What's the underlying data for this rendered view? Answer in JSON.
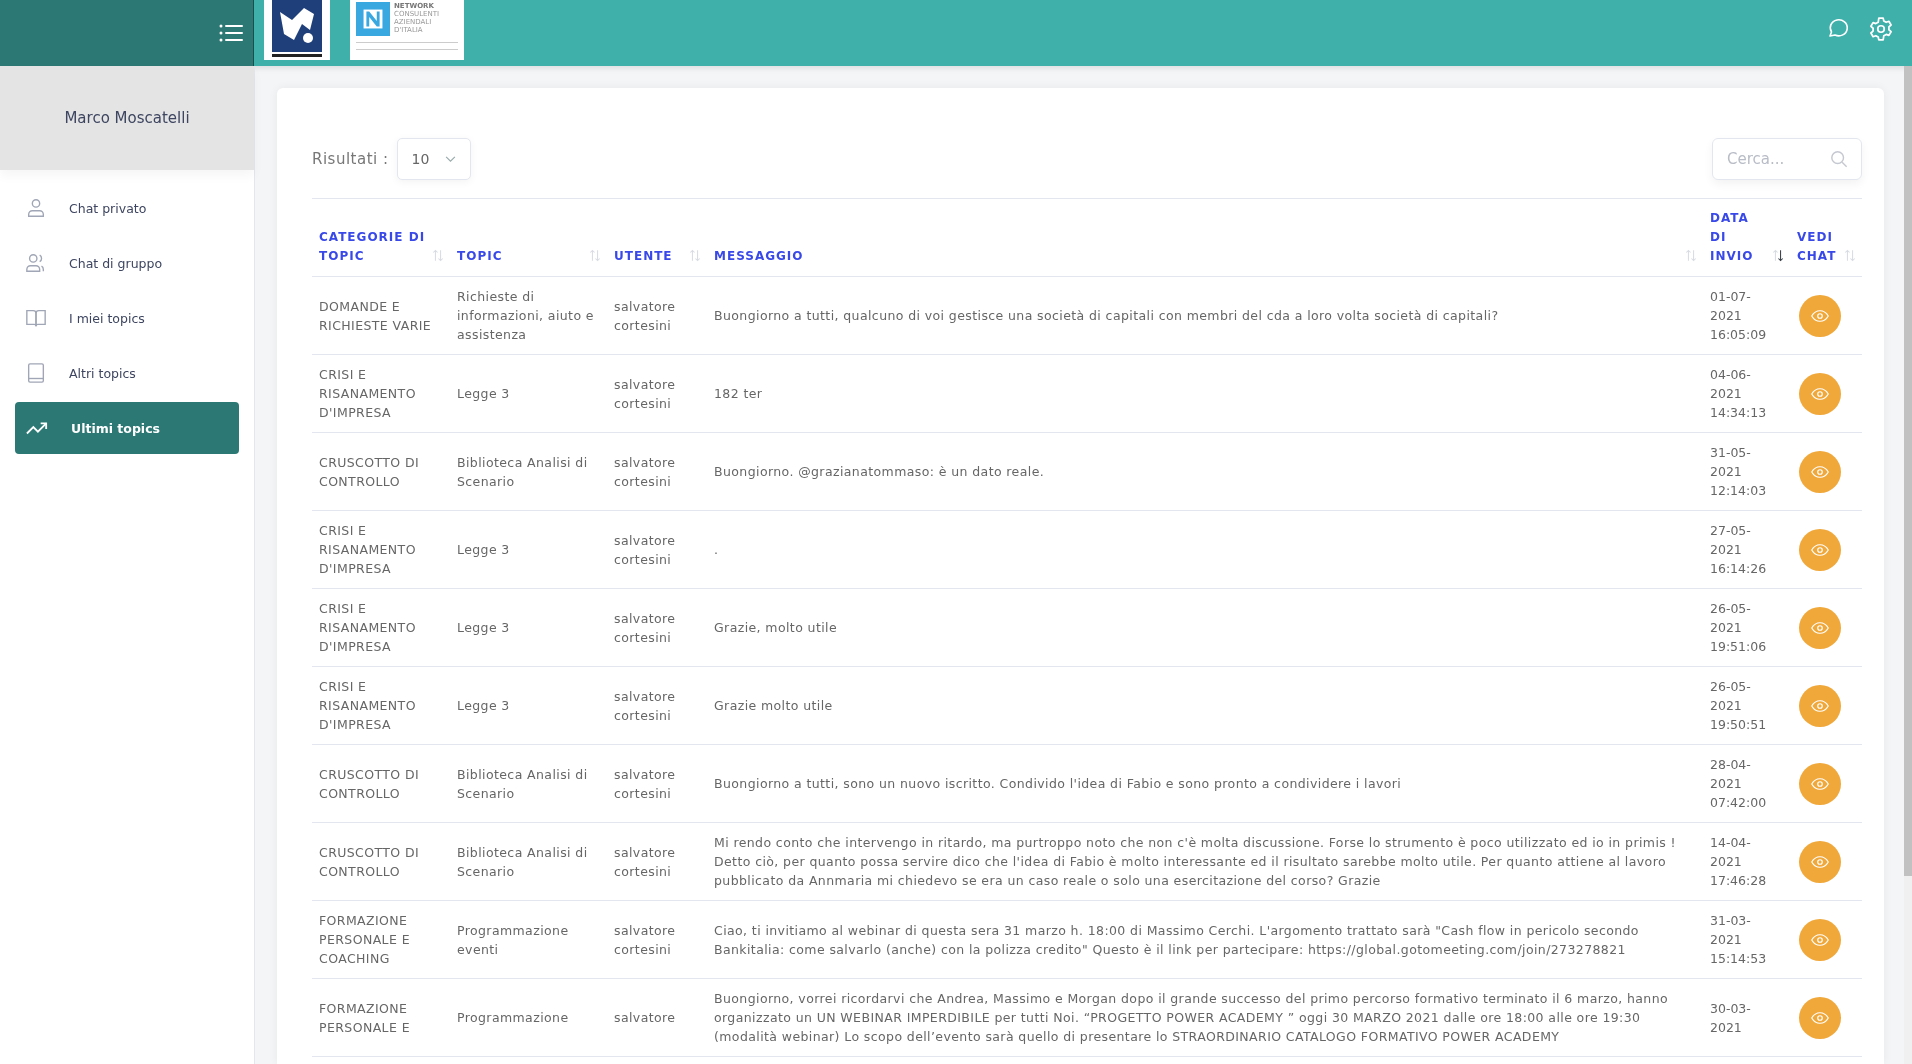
{
  "header": {
    "logo_network": {
      "lines": [
        "NETWORK",
        "CONSULENTI",
        "AZIENDALI",
        "D'ITALIA"
      ]
    }
  },
  "sidebar": {
    "user": "Marco Moscatelli",
    "items": [
      {
        "label": "Chat privato",
        "kind": "person",
        "selected": false
      },
      {
        "label": "Chat di gruppo",
        "kind": "group",
        "selected": false
      },
      {
        "label": "I miei topics",
        "kind": "book-open",
        "selected": false
      },
      {
        "label": "Altri topics",
        "kind": "book",
        "selected": false
      },
      {
        "label": "Ultimi topics",
        "kind": "trend",
        "selected": true
      }
    ]
  },
  "filters": {
    "results_label": "Risultati :",
    "page_size": "10",
    "search": {
      "placeholder": "Cerca..."
    }
  },
  "table": {
    "columns": [
      {
        "lines": [
          "CATEGORIE DI",
          "TOPIC"
        ],
        "sorted": false
      },
      {
        "lines": [
          "TOPIC"
        ],
        "sorted": false
      },
      {
        "lines": [
          "UTENTE"
        ],
        "sorted": false
      },
      {
        "lines": [
          "MESSAGGIO"
        ],
        "sorted": false
      },
      {
        "lines": [
          "DATA",
          "DI",
          "INVIO"
        ],
        "sorted": true
      },
      {
        "lines": [
          "VEDI",
          "CHAT"
        ],
        "sorted": false
      }
    ],
    "rows": [
      {
        "category": "DOMANDE E RICHIESTE VARIE",
        "topic": "Richieste di informazioni, aiuto e assistenza",
        "user": "salvatore cortesini",
        "message": "Buongiorno a tutti, qualcuno di voi gestisce una società di capitali con membri del cda a loro volta società di capitali?",
        "date": [
          "01-07-",
          "2021",
          "16:05:09"
        ]
      },
      {
        "category": "CRISI E RISANAMENTO D'IMPRESA",
        "topic": "Legge 3",
        "user": "salvatore cortesini",
        "message": "182 ter",
        "date": [
          "04-06-",
          "2021",
          "14:34:13"
        ]
      },
      {
        "category": "CRUSCOTTO DI CONTROLLO",
        "topic": "Biblioteca Analisi di Scenario",
        "user": "salvatore cortesini",
        "message": "Buongiorno. @grazianatommaso: è un dato reale.",
        "date": [
          "31-05-",
          "2021",
          "12:14:03"
        ]
      },
      {
        "category": "CRISI E RISANAMENTO D'IMPRESA",
        "topic": "Legge 3",
        "user": "salvatore cortesini",
        "message": ".",
        "date": [
          "27-05-",
          "2021",
          "16:14:26"
        ]
      },
      {
        "category": "CRISI E RISANAMENTO D'IMPRESA",
        "topic": "Legge 3",
        "user": "salvatore cortesini",
        "message": "Grazie, molto utile",
        "date": [
          "26-05-",
          "2021",
          "19:51:06"
        ]
      },
      {
        "category": "CRISI E RISANAMENTO D'IMPRESA",
        "topic": "Legge 3",
        "user": "salvatore cortesini",
        "message": "Grazie molto utile",
        "date": [
          "26-05-",
          "2021",
          "19:50:51"
        ]
      },
      {
        "category": "CRUSCOTTO DI CONTROLLO",
        "topic": "Biblioteca Analisi di Scenario",
        "user": "salvatore cortesini",
        "message": "Buongiorno a tutti, sono un nuovo iscritto. Condivido l'idea di Fabio e sono pronto a condividere i lavori",
        "date": [
          "28-04-",
          "2021",
          "07:42:00"
        ]
      },
      {
        "category": "CRUSCOTTO DI CONTROLLO",
        "topic": "Biblioteca Analisi di Scenario",
        "user": "salvatore cortesini",
        "message": "Mi rendo conto che intervengo in ritardo, ma purtroppo noto che non c'è molta discussione. Forse lo strumento è poco utilizzato ed io in primis ! Detto ciò, per quanto possa servire dico che l'idea di Fabio è molto interessante ed il risultato sarebbe molto utile. Per quanto attiene al lavoro pubblicato da Annmaria mi chiedevo se era un caso reale o solo una esercitazione del corso? Grazie",
        "date": [
          "14-04-",
          "2021",
          "17:46:28"
        ]
      },
      {
        "category": "FORMAZIONE PERSONALE E COACHING",
        "topic": "Programmazione eventi",
        "user": "salvatore cortesini",
        "message": "Ciao, ti invitiamo al webinar di questa sera 31 marzo h. 18:00 di Massimo Cerchi. L'argomento trattato sarà \"Cash flow in pericolo secondo Bankitalia: come salvarlo (anche) con la polizza credito\" Questo è il link per partecipare: https://global.gotomeeting.com/join/273278821",
        "date": [
          "31-03-",
          "2021",
          "15:14:53"
        ]
      },
      {
        "category": "FORMAZIONE PERSONALE E",
        "topic": "Programmazione",
        "user": "salvatore",
        "message": "Buongiorno, vorrei ricordarvi che Andrea, Massimo e Morgan dopo il grande successo del primo percorso formativo terminato il 6 marzo, hanno organizzato un UN WEBINAR IMPERDIBILE per tutti Noi. “PROGETTO POWER ACADEMY ” oggi 30 MARZO 2021 dalle ore 18:00 alle ore 19:30 (modalità webinar) Lo scopo dell’evento sarà quello di presentare lo STRAORDINARIO CATALOGO FORMATIVO POWER ACADEMY",
        "date": [
          "30-03-",
          "2021"
        ]
      }
    ]
  }
}
